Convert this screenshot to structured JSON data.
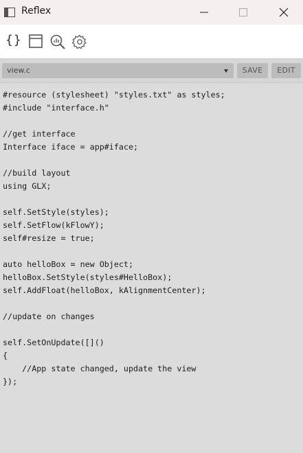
{
  "window": {
    "title": "Reflex",
    "icons": {
      "app": "window-icon",
      "minimize": "minimize-icon",
      "maximize": "maximize-icon",
      "close": "close-icon"
    }
  },
  "toolbar": {
    "braces_label": "{}",
    "icons": [
      "braces-icon",
      "page-icon",
      "inspect-chart-icon",
      "gear-icon"
    ]
  },
  "filebar": {
    "selected_file": "view.c",
    "save_label": "SAVE",
    "edit_label": "EDIT"
  },
  "editor": {
    "code": "#resource (stylesheet) \"styles.txt\" as styles;\n#include \"interface.h\"\n\n//get interface\nInterface iface = app#iface;\n\n//build layout\nusing GLX;\n\nself.SetStyle(styles);\nself.SetFlow(kFlowY);\nself#resize = true;\n\nauto helloBox = new Object;\nhelloBox.SetStyle(styles#HelloBox);\nself.AddFloat(helloBox, kAlignmentCenter);\n\n//update on changes\n\nself.SetOnUpdate([]()\n{\n    //App state changed, update the view\n});"
  }
}
